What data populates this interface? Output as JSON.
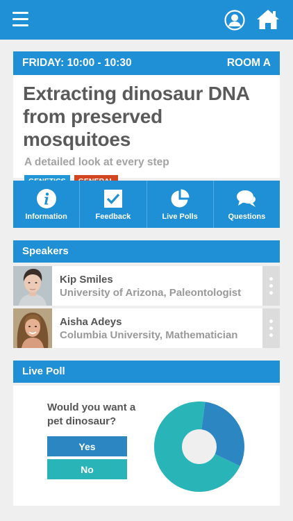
{
  "header": {
    "menu_icon": "hamburger-menu-icon",
    "user_icon": "user-profile-icon",
    "home_icon": "home-icon"
  },
  "session": {
    "time": "FRIDAY: 10:00 - 10:30",
    "room": "ROOM A",
    "title_line1": "Extracting dinosaur DNA",
    "title_line2": "from preserved mosquitoes",
    "subtitle": "A detailed look at every step",
    "tags": [
      {
        "label": "GENETICS",
        "color": "#2196d8"
      },
      {
        "label": "GENERAL",
        "color": "#d24521"
      }
    ]
  },
  "actions": [
    {
      "label": "Information",
      "icon": "info-icon"
    },
    {
      "label": "Feedback",
      "icon": "checkbox-icon"
    },
    {
      "label": "Live Polls",
      "icon": "pie-chart-icon"
    },
    {
      "label": "Questions",
      "icon": "chat-bubbles-icon"
    }
  ],
  "speakers": {
    "title": "Speakers",
    "items": [
      {
        "name": "Kip Smiles",
        "role": "University of Arizona, Paleontologist"
      },
      {
        "name": "Aisha Adeys",
        "role": "Columbia University, Mathematician"
      }
    ]
  },
  "poll": {
    "title": "Live Poll",
    "question": "Would you want a pet dinosaur?",
    "options": [
      {
        "label": "Yes",
        "share": 0.3,
        "color": "#2b86c2"
      },
      {
        "label": "No",
        "share": 0.7,
        "color": "#29b4b8"
      }
    ]
  },
  "colors": {
    "brand": "#1f8fd6",
    "background": "#efefef"
  }
}
